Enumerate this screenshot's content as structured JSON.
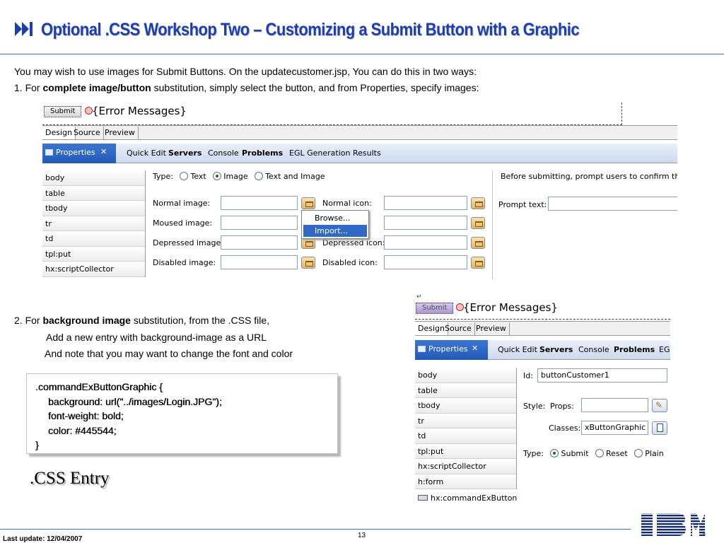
{
  "slide": {
    "title": "Optional .CSS Workshop Two – Customizing a Submit Button with a Graphic",
    "intro": "You may wish to use images for Submit Buttons.  On the updatecustomer.jsp, You can do this in two ways:",
    "point1": {
      "prefix": "1. For ",
      "bold": "complete image/button",
      "rest": " substitution, simply select the button, and from Properties, specify images:"
    },
    "point2": {
      "prefix": "2. For ",
      "bold": "background image",
      "rest": " substitution, from the .CSS file,"
    },
    "point2_sub1": "Add a new entry with background-image as a URL",
    "point2_sub2": "And note that you may want to change the font and color",
    "css_code": [
      ".commandExButtonGraphic {",
      "background: url(\"../images/Login.JPG\");",
      "font-weight: bold;",
      "color: #445544;",
      "}"
    ],
    "css_entry_caption": ".CSS Entry",
    "footer": {
      "last_update": "Last update: 12/04/2007",
      "page_number": "13"
    },
    "colors": {
      "title": "#1d3fae",
      "rule": "#3a6fbf",
      "properties_tab": "#225ab8"
    }
  },
  "screenshot1": {
    "submit_label": "Submit",
    "error_messages": "{Error Messages}",
    "editor_tabs": [
      "Design",
      "Source",
      "Preview"
    ],
    "properties_label": "Properties",
    "close_glyph": "✕",
    "view_tabs": [
      "Quick Edit",
      "Servers",
      "Console",
      "Problems",
      "EGL Generation Results"
    ],
    "tree": [
      "body",
      "table",
      "tbody",
      "tr",
      "td",
      "tpl:put",
      "hx:scriptCollector"
    ],
    "type_label": "Type:",
    "type_options": [
      "Text",
      "Image",
      "Text and Image"
    ],
    "type_selected": "Image",
    "normal_image_label": "Normal image:",
    "moused_image_label": "Moused image:",
    "depressed_image_label": "Depressed image:",
    "disabled_image_label": "Disabled image:",
    "normal_icon_label": "Normal icon:",
    "depressed_icon_label": "Depressed icon:",
    "disabled_icon_label": "Disabled icon:",
    "menu_items": [
      "Browse...",
      "Import..."
    ],
    "menu_selected": "Import...",
    "confirm_text": "Before submitting, prompt users to confirm they",
    "prompt_text_label": "Prompt text:"
  },
  "screenshot2": {
    "submit_label": "Submit",
    "error_messages": "{Error Messages}",
    "editor_tabs": [
      "Design",
      "Source",
      "Preview"
    ],
    "properties_label": "Properties",
    "close_glyph": "✕",
    "view_tabs": [
      "Quick Edit",
      "Servers",
      "Console",
      "Problems",
      "EG"
    ],
    "tree": [
      "body",
      "table",
      "tbody",
      "tr",
      "td",
      "tpl:put",
      "hx:scriptCollector",
      "h:form"
    ],
    "selected_node": "hx:commandExButton",
    "id_label": "Id:",
    "id_value": "buttonCustomer1",
    "style_label": "Style:",
    "props_label": "Props:",
    "props_value": "",
    "classes_label": "Classes:",
    "classes_value": "xButtonGraphic",
    "type_label": "Type:",
    "type_options": [
      "Submit",
      "Reset",
      "Plain"
    ],
    "type_selected": "Submit"
  }
}
